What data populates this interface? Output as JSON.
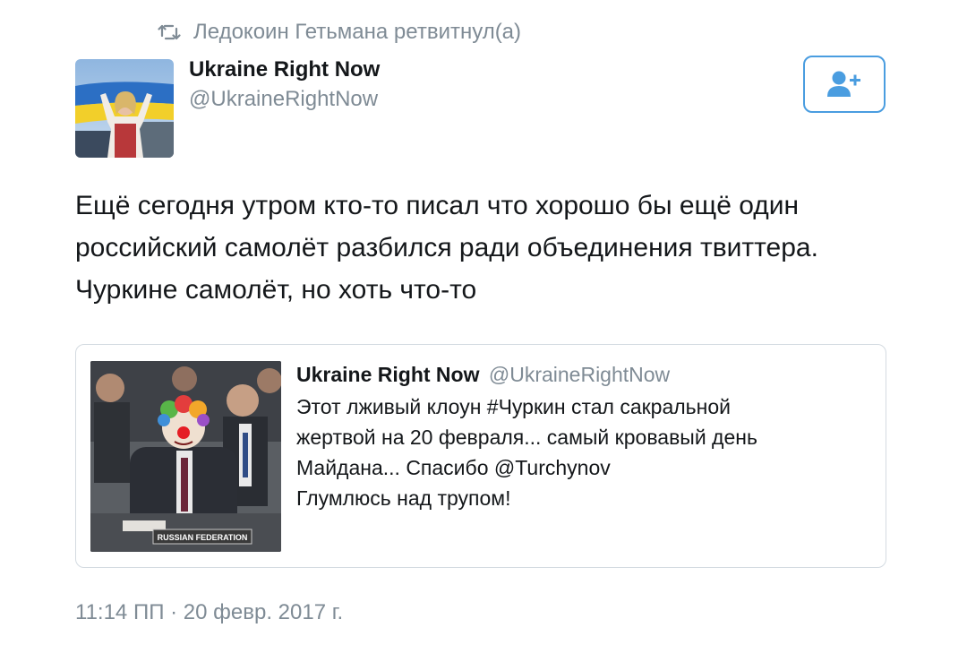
{
  "retweet": {
    "text": "Ледокоин Гетьмана ретвитнул(а)",
    "icon": "retweet-icon"
  },
  "author": {
    "name": "Ukraine Right Now",
    "handle": "@UkraineRightNow",
    "avatar_icon": "avatar-woman-with-ukrainian-flag"
  },
  "follow_button": {
    "icon": "add-user-icon",
    "color": "#4a9de0"
  },
  "tweet": {
    "lines": [
      "Ещё сегодня утром кто-то писал что хорошо бы ещё один",
      "российский самолёт разбился ради объединения твиттера.",
      "Чуркине самолёт, но хоть что-то"
    ]
  },
  "quote": {
    "name": "Ukraine Right Now",
    "handle": "@UkraineRightNow",
    "lines": [
      "Этот лживый клоун #Чуркин стал сакральной",
      "жертвой на 20 февраля... самый кровавый день",
      "Майдана... Спасибо @Turchynov",
      "Глумлюсь над трупом!"
    ],
    "media": {
      "nameplate": "RUSSIAN FEDERATION"
    }
  },
  "timestamp": "11:14 ПП · 20 февр. 2017 г.",
  "colors": {
    "accent": "#4a9de0",
    "muted": "#7f8b95",
    "text": "#14171a",
    "border": "#d4dbe1"
  }
}
